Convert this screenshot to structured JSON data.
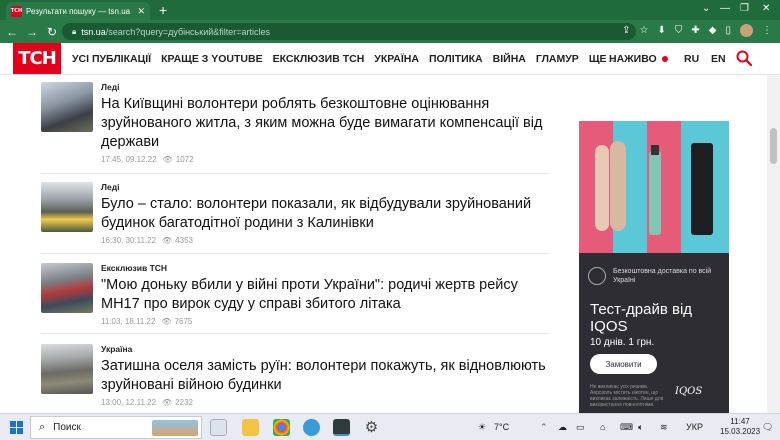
{
  "browser": {
    "tab_title": "Результати пошуку — tsn.ua",
    "tab_favicon_text": "ТСН",
    "url_host": "tsn.ua",
    "url_rest": "/search?query=дубінський&filter=articles"
  },
  "site": {
    "logo": "ТСН",
    "menu": [
      "УСІ ПУБЛІКАЦІЇ",
      "КРАЩЕ З YOUTUBE",
      "ЕКСКЛЮЗИВ ТСН",
      "УКРАЇНА",
      "ПОЛІТИКА",
      "ВІЙНА",
      "ГЛАМУР",
      "ЩЕ"
    ],
    "live_label": "НАЖИВО",
    "languages": [
      "RU",
      "EN"
    ],
    "accent_color": "#e3001b"
  },
  "articles": [
    {
      "category": "Леді",
      "headline": "На Київщині волонтери роблять безкоштовне оцінювання зруйнованого житла, з яким можна буде вимагати компенсації від держави",
      "time": "17:45, 09.12.22",
      "views": "1072"
    },
    {
      "category": "Леді",
      "headline": "Було – стало: волонтери показали, як відбудували зруйнований будинок багатодітної родини з Калинівки",
      "time": "16:30, 30.11.22",
      "views": "4353"
    },
    {
      "category": "Ексклюзив ТСН",
      "headline": "\"Мою доньку вбили у війні проти України\": родичі жертв рейсу MH17 про вирок суду у справі збитого літака",
      "time": "11:03, 18.11.22",
      "views": "7675"
    },
    {
      "category": "Україна",
      "headline": "Затишна оселя замість руїн: волонтери покажуть, як відновлюють зруйновані війною будинки",
      "time": "13:00, 12.11.22",
      "views": "2232"
    }
  ],
  "ad": {
    "delivery_text": "Безкоштовна доставка по всій Україні",
    "headline": "Тест-драйв від IQOS",
    "subline": "10 днів. 1 грн.",
    "button": "Замовити",
    "disclaimer": "Не викликає усіх ризиків. Аерозоль містить нікотин, що викликає залежність. Лише для використання повнолітніми.",
    "brand": "IQOS",
    "stripe_colors": [
      "#e65a7a",
      "#5bc8d8",
      "#e65a7a",
      "#5bc8d8"
    ]
  },
  "taskbar": {
    "search_label": "Поиск",
    "weather": "7°C",
    "language": "УКР",
    "time": "11:47",
    "date": "15.03.2023"
  }
}
